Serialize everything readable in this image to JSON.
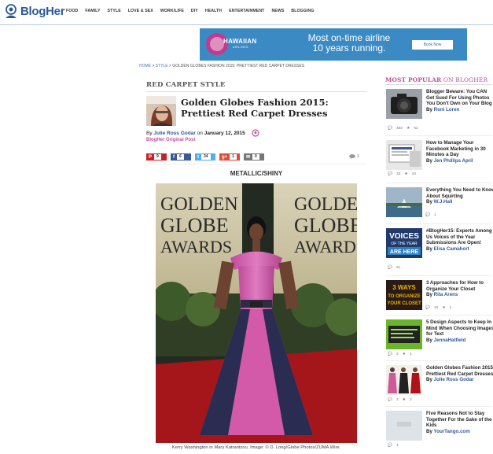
{
  "brand": {
    "name": "BlogHer"
  },
  "nav": [
    "FOOD",
    "FAMILY",
    "STYLE",
    "LOVE & SEX",
    "WORK/LIFE",
    "DIY",
    "HEALTH",
    "ENTERTAINMENT",
    "NEWS",
    "BLOGGING"
  ],
  "ad": {
    "airline": "HAWAIIAN",
    "airline_sub": "AIRLINES",
    "headline_line1": "Most on-time airline",
    "headline_line2": "10 years running.",
    "button": "Book Now"
  },
  "breadcrumb": {
    "home": "HOME",
    "sep1": " > ",
    "section": "STYLE",
    "sep2": " > ",
    "current": "GOLDEN GLOBES FASHION 2015: PRETTIEST RED CARPET DRESSES"
  },
  "article": {
    "kicker": "RED CARPET STYLE",
    "title": "Golden Globes Fashion 2015: Prettiest Red Carpet Dresses",
    "by": "By",
    "author": "Julie Ross Godar",
    "on": "on",
    "date": "January 12, 2015",
    "original_post": "BlogHer Original Post",
    "shares": {
      "pinterest": "9",
      "facebook": "6",
      "twitter": "34",
      "googleplus": "1",
      "email": "0"
    },
    "comments": "3",
    "section_label": "METALLIC/SHINY",
    "photo_text": [
      "GOLDEN",
      "GLOBE",
      "AWARDS"
    ],
    "caption": "Kerry Washington in Mary Katrantzou. Image: © D. Long/Globe Photos/ZUMA Wire."
  },
  "sidebar": {
    "title_part1": "MOST POPULAR",
    "title_part2": " ON BLOGHER",
    "items": [
      {
        "title": "Blogger Beware: You CAN Get Sued For Using Photos You Don't Own on Your Blog",
        "by": "By",
        "author": "Roni Loren",
        "comments": "480",
        "stars": "62"
      },
      {
        "title": "How to Manage Your Facebook Marketing in 30 Minutes a Day",
        "by": "By",
        "author": "Jen Phillips April",
        "comments": "32",
        "stars": "10"
      },
      {
        "title": "Everything You Need to Know About Squirting",
        "by": "By",
        "author": "W.J.Hall",
        "comments": "",
        "stars": "1"
      },
      {
        "title": "#BlogHer15: Experts Among Us Voices of the Year Submissions Are Open!",
        "by": "By",
        "author": "Elisa Camahort",
        "comments": "51",
        "stars": ""
      },
      {
        "title": "3 Approaches for How to Organize Your Closet",
        "by": "By",
        "author": "Rita Arens",
        "comments": "15",
        "stars": "1"
      },
      {
        "title": "5 Design Aspects to Keep In Mind When Choosing Images for Text",
        "by": "By",
        "author": "JennaHatfield",
        "comments": "3",
        "stars": "1"
      },
      {
        "title": "Golden Globes Fashion 2015: Prettiest Red Carpet Dresses",
        "by": "By",
        "author": "Julie Ross Godar",
        "comments": "3",
        "stars": "2"
      },
      {
        "title": "Five Reasons Not to Stay Together For the Sake of the Kids",
        "by": "By",
        "author": "YourTango.com",
        "comments": "4",
        "stars": ""
      }
    ],
    "thumb_texts": {
      "voices1": "VOICES",
      "voices2": "OF THE YEAR",
      "voices3": "ARE HERE",
      "ways1": "3 WAYS",
      "ways2": "TO ORGANIZE",
      "ways3": "YOUR CLOSET"
    }
  },
  "colors": {
    "brand_blue": "#2b5a9a",
    "accent_pink": "#c54da0",
    "ad_blue": "#3c8ac4"
  }
}
